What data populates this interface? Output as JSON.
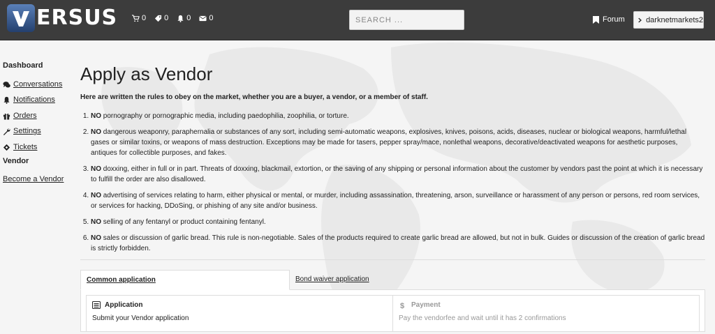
{
  "brand": {
    "logo_text": "ERSUS",
    "logo_letter": "V"
  },
  "topbar": {
    "counters": [
      {
        "icon": "cart-icon",
        "value": "0"
      },
      {
        "icon": "tag-icon",
        "value": "0"
      },
      {
        "icon": "bell-icon",
        "value": "0"
      },
      {
        "icon": "envelope-icon",
        "value": "0"
      }
    ],
    "search_placeholder": "SEARCH ...",
    "forum_label": "Forum",
    "username": "darknetmarkets2"
  },
  "sidebar": {
    "dashboard_heading": "Dashboard",
    "items": [
      {
        "label": "Conversations",
        "icon": "comments-icon"
      },
      {
        "label": "Notifications",
        "icon": "bell-icon"
      },
      {
        "label": "Orders",
        "icon": "gift-icon"
      },
      {
        "label": "Settings",
        "icon": "wrench-icon"
      },
      {
        "label": "Tickets",
        "icon": "ticket-icon"
      }
    ],
    "vendor_heading": "Vendor",
    "become_vendor": "Become a Vendor"
  },
  "main": {
    "title": "Apply as Vendor",
    "intro": "Here are written the rules to obey on the market, whether you are a buyer, a vendor, or a member of staff.",
    "rules": [
      {
        "lead": "NO",
        "text": " pornography or pornographic media, including paedophilia, zoophilia, or torture."
      },
      {
        "lead": "NO",
        "text": " dangerous weaponry, paraphernalia or substances of any sort, including semi-automatic weapons, explosives, knives, poisons, acids, diseases, nuclear or biological weapons, harmful/lethal gases or similar toxins, or weapons of mass destruction. Exceptions may be made for tasers, pepper spray/mace, nonlethal weapons, decorative/deactivated weapons for aesthetic purposes, antiques for collectible purposes, and fakes."
      },
      {
        "lead": "NO",
        "text": " doxxing, either in full or in part. Threats of doxxing, blackmail, extortion, or the saving of any shipping or personal information about the customer by vendors past the point at which it is necessary to fulfill the order are also disallowed."
      },
      {
        "lead": "NO",
        "text": " advertising of services relating to harm, either physical or mental, or murder, including assassination, threatening, arson, surveillance or harassment of any person or persons, red room services, or services for hacking, DDoSing, or phishing of any site and/or business."
      },
      {
        "lead": "NO",
        "text": " selling of any fentanyl or product containing fentanyl."
      },
      {
        "lead": "NO",
        "text": " sales or discussion of garlic bread. This rule is non-negotiable. Sales of the products required to create garlic bread are allowed, but not in bulk. Guides or discussion of the creation of garlic bread is strictly forbidden."
      }
    ],
    "tabs": [
      {
        "label": "Common application",
        "active": true
      },
      {
        "label": "Bond waiver application",
        "active": false
      }
    ],
    "steps": [
      {
        "title": "Application",
        "desc": "Submit your Vendor application",
        "icon": "list-icon"
      },
      {
        "title": "Payment",
        "desc": "Pay the vendorfee and wait until it has 2 confirmations",
        "icon": "dollar-icon"
      }
    ]
  },
  "colors": {
    "topbar": "#3c3c3c",
    "page_bg": "#f5f5f5",
    "logo_blue": "#3f66a0"
  }
}
